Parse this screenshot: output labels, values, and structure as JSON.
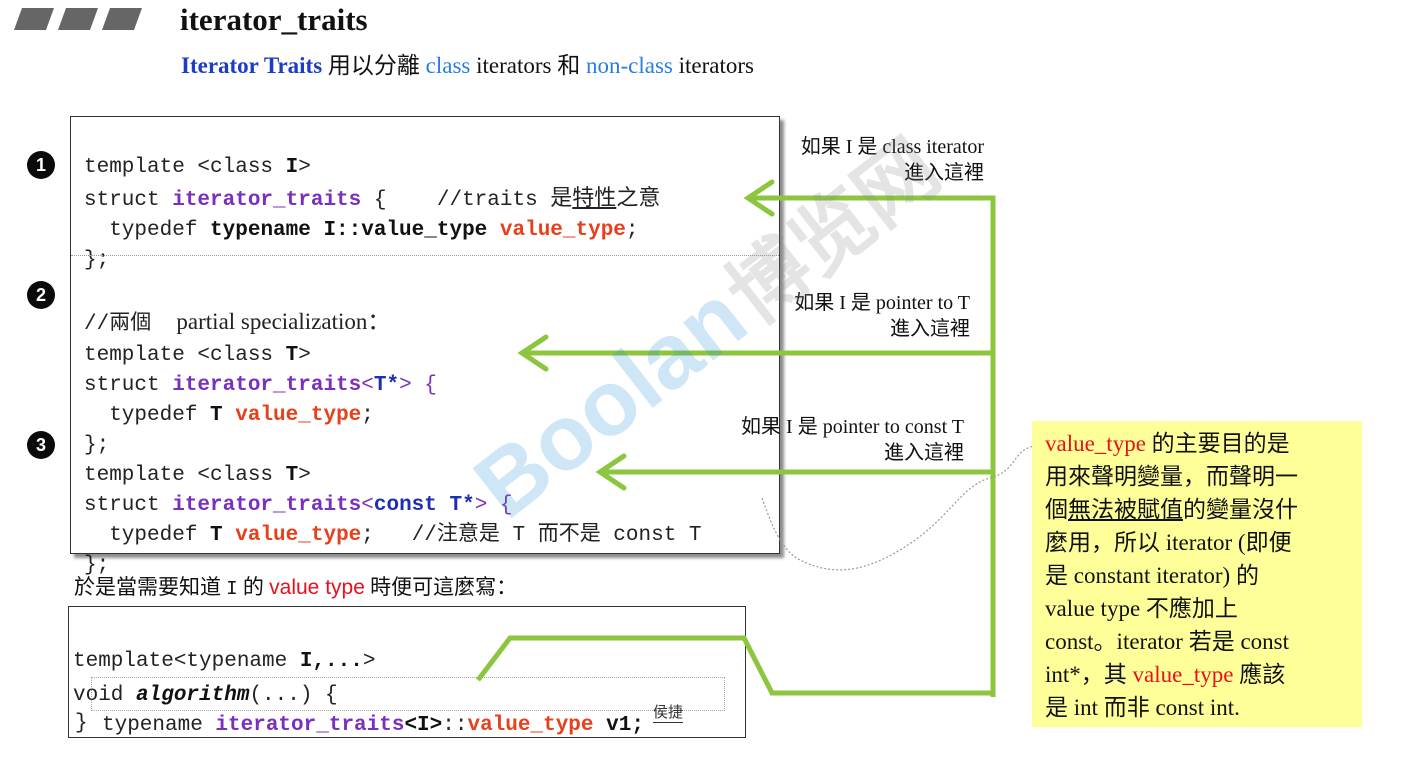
{
  "header": {
    "title": "iterator_traits",
    "subtitle_parts": [
      "Iterator Traits",
      " 用以分離 ",
      "class",
      " iterators 和 ",
      "non-class",
      " iterators"
    ]
  },
  "badges": [
    "1",
    "2",
    "3"
  ],
  "code_box_1": {
    "line1": [
      "template <class ",
      "I",
      ">"
    ],
    "line2": [
      "struct ",
      "iterator_traits",
      " {    //traits ",
      "是",
      "特性",
      "之意"
    ],
    "line3": [
      "  typedef ",
      "typename I::value_type",
      " ",
      "value_type",
      ";"
    ],
    "line4": "};"
  },
  "code_box_2": {
    "comment": [
      "//兩個  ",
      "partial specialization："
    ],
    "line1": [
      "template <class ",
      "T",
      ">"
    ],
    "line2": [
      "struct ",
      "iterator_traits",
      "<",
      "T*",
      "> {"
    ],
    "line3": [
      "  typedef ",
      "T",
      " ",
      "value_type",
      ";"
    ],
    "line4": "};",
    "line5": [
      "template <class ",
      "T",
      ">"
    ],
    "line6": [
      "struct ",
      "iterator_traits",
      "<",
      "const T*",
      "> {"
    ],
    "line7": [
      "  typedef ",
      "T",
      " ",
      "value_type",
      ";   //注意是 T 而不是 const T"
    ],
    "line8": "};"
  },
  "annotations": {
    "a1_line1": "如果 I 是 class iterator",
    "a1_line2": "進入這裡",
    "a2_line1": "如果 I 是 pointer to T",
    "a2_line2": "進入這裡",
    "a3_line1": "如果 I 是 pointer to const T",
    "a3_line2": "進入這裡"
  },
  "usage_caption": [
    "於是當需要知道 ",
    "I",
    " 的 ",
    "value type",
    " 時便可這麼寫："
  ],
  "code_box_3": {
    "line1": [
      "template<typename ",
      "I,...",
      ">"
    ],
    "line2": [
      "void ",
      "algorithm",
      "(...) {"
    ],
    "line3": [
      "typename ",
      "iterator_traits",
      "<I>",
      "::",
      "value_type",
      " v1;"
    ],
    "line4": "}",
    "watermark_small": "侯捷"
  },
  "side_note": {
    "lines": [
      [
        "value_type",
        " 的主要目的是"
      ],
      [
        "用來聲明變量，而聲明一"
      ],
      [
        "個",
        "無法被賦值",
        "的變量沒什"
      ],
      [
        "麼用，所以 iterator (即便"
      ],
      [
        "是 constant iterator) 的"
      ],
      [
        "value type 不應加上"
      ],
      [
        "const。iterator 若是 const"
      ],
      [
        "int*，其 ",
        "value_type",
        " 應該"
      ],
      [
        "是 int 而非 const int."
      ]
    ]
  },
  "watermark": {
    "brand": "Boolan",
    "cn": "博览网"
  },
  "colors": {
    "arrow_green": "#8cc63f",
    "note_bg": "#ffff99",
    "keyword_purple": "#7b2fbf",
    "keyword_red": "#e8401c",
    "keyword_blue": "#1f2fb5",
    "title_blue": "#1a3cc8"
  }
}
